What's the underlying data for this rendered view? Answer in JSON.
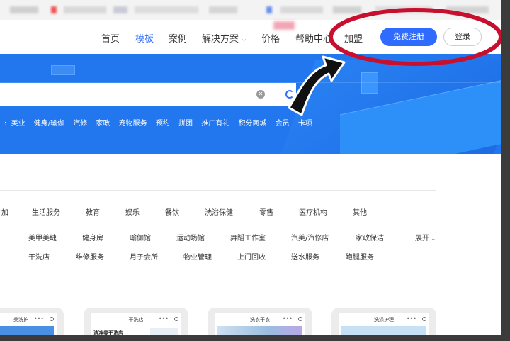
{
  "nav": {
    "items": [
      {
        "label": "首页",
        "active": false
      },
      {
        "label": "模板",
        "active": true
      },
      {
        "label": "案例",
        "active": false
      },
      {
        "label": "解决方案",
        "active": false,
        "dropdown": true
      },
      {
        "label": "价格",
        "active": false
      },
      {
        "label": "帮助中心",
        "active": false
      },
      {
        "label": "加盟",
        "active": false
      }
    ],
    "register_label": "免费注册",
    "login_label": "登录"
  },
  "hero": {
    "hot_tags": [
      "美业",
      "健身/瑜伽",
      "汽修",
      "家政",
      "宠物服务",
      "预约",
      "拼团",
      "推广有礼",
      "积分商城",
      "会员",
      "卡项"
    ],
    "hot_tags_prefix": ":"
  },
  "categories": {
    "row1": [
      "加",
      "生活服务",
      "教育",
      "娱乐",
      "餐饮",
      "洗浴保健",
      "零售",
      "医疗机构",
      "其他"
    ],
    "row2": [
      "美甲美睫",
      "健身房",
      "瑜伽馆",
      "运动场馆",
      "舞蹈工作室",
      "汽美/汽修店",
      "家政保洁"
    ],
    "row3": [
      "干洗店",
      "维修服务",
      "月子会所",
      "物业管理",
      "上门回收",
      "送水服务",
      "跑腿服务"
    ],
    "expand_label": "展开"
  },
  "cards": [
    {
      "title": "美洗护",
      "subtitle": ""
    },
    {
      "title": "干洗店",
      "subtitle": "洁净美干洗店"
    },
    {
      "title": "洗衣干衣",
      "subtitle": ""
    },
    {
      "title": "洗涤护理",
      "subtitle": ""
    }
  ],
  "colors": {
    "accent": "#2f6bff",
    "hero": "#2277ee",
    "annotation_red": "#c8102e"
  }
}
